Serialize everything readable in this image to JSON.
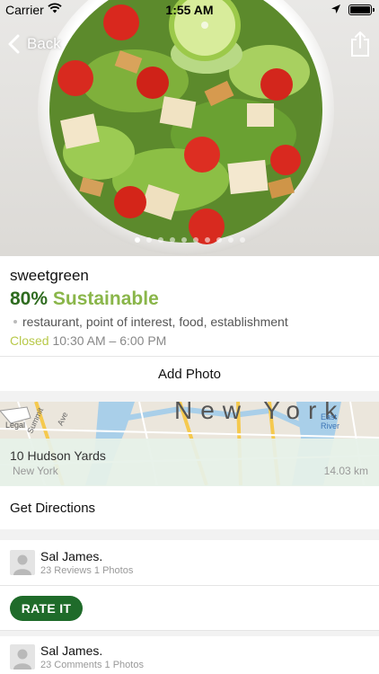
{
  "status_bar": {
    "carrier": "Carrier",
    "time": "1:55 AM"
  },
  "nav": {
    "back_label": "Back"
  },
  "photo": {
    "page_count": 10,
    "active_page": 1,
    "subject": "salad bowl"
  },
  "place": {
    "name": "sweetgreen",
    "score_pct": "80%",
    "score_label": "Sustainable",
    "types": "restaurant, point of interest, food, establishment",
    "status": "Closed",
    "hours": "10:30 AM – 6:00 PM"
  },
  "actions": {
    "add_photo": "Add Photo",
    "get_directions": "Get Directions",
    "rate_it": "RATE IT"
  },
  "map": {
    "city_label": "New York",
    "labels": {
      "legal": "Legal",
      "east_river": "East River",
      "summit": "Summit",
      "ave": "Ave"
    },
    "address": "10 Hudson Yards",
    "city": "New York",
    "distance": "14.03 km"
  },
  "reviews": [
    {
      "name": "Sal James.",
      "meta": "23 Reviews  1 Photos"
    },
    {
      "name": "Sal James.",
      "meta": "23 Comments  1 Photos"
    }
  ],
  "colors": {
    "accent_green": "#1f6b2a",
    "score_dark": "#2e6b1f",
    "score_light": "#8ab64a",
    "closed": "#b8c94a"
  }
}
